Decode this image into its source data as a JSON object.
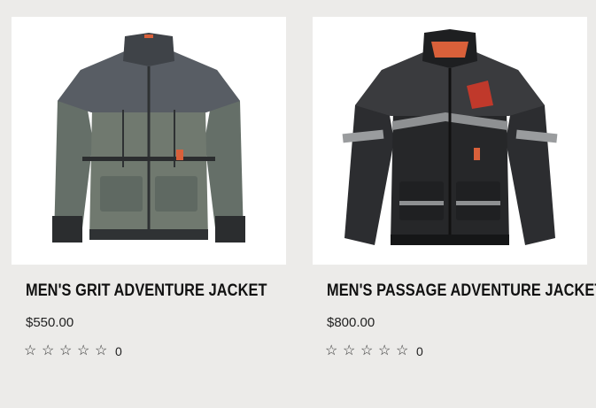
{
  "products": [
    {
      "name": "MEN'S GRIT ADVENTURE JACKET",
      "price": "$550.00",
      "rating_stars": 0,
      "review_count": "0",
      "image_icon": "jacket-grit-image",
      "colors": {
        "body": "#6e7a70",
        "yoke": "#5b6068",
        "accent": "#d9603a"
      }
    },
    {
      "name": "MEN'S PASSAGE ADVENTURE JACKET",
      "price": "$800.00",
      "rating_stars": 0,
      "review_count": "0",
      "image_icon": "jacket-passage-image",
      "colors": {
        "body": "#2a2b2d",
        "yoke": "#3a3b3e",
        "accent": "#d9603a"
      }
    }
  ]
}
